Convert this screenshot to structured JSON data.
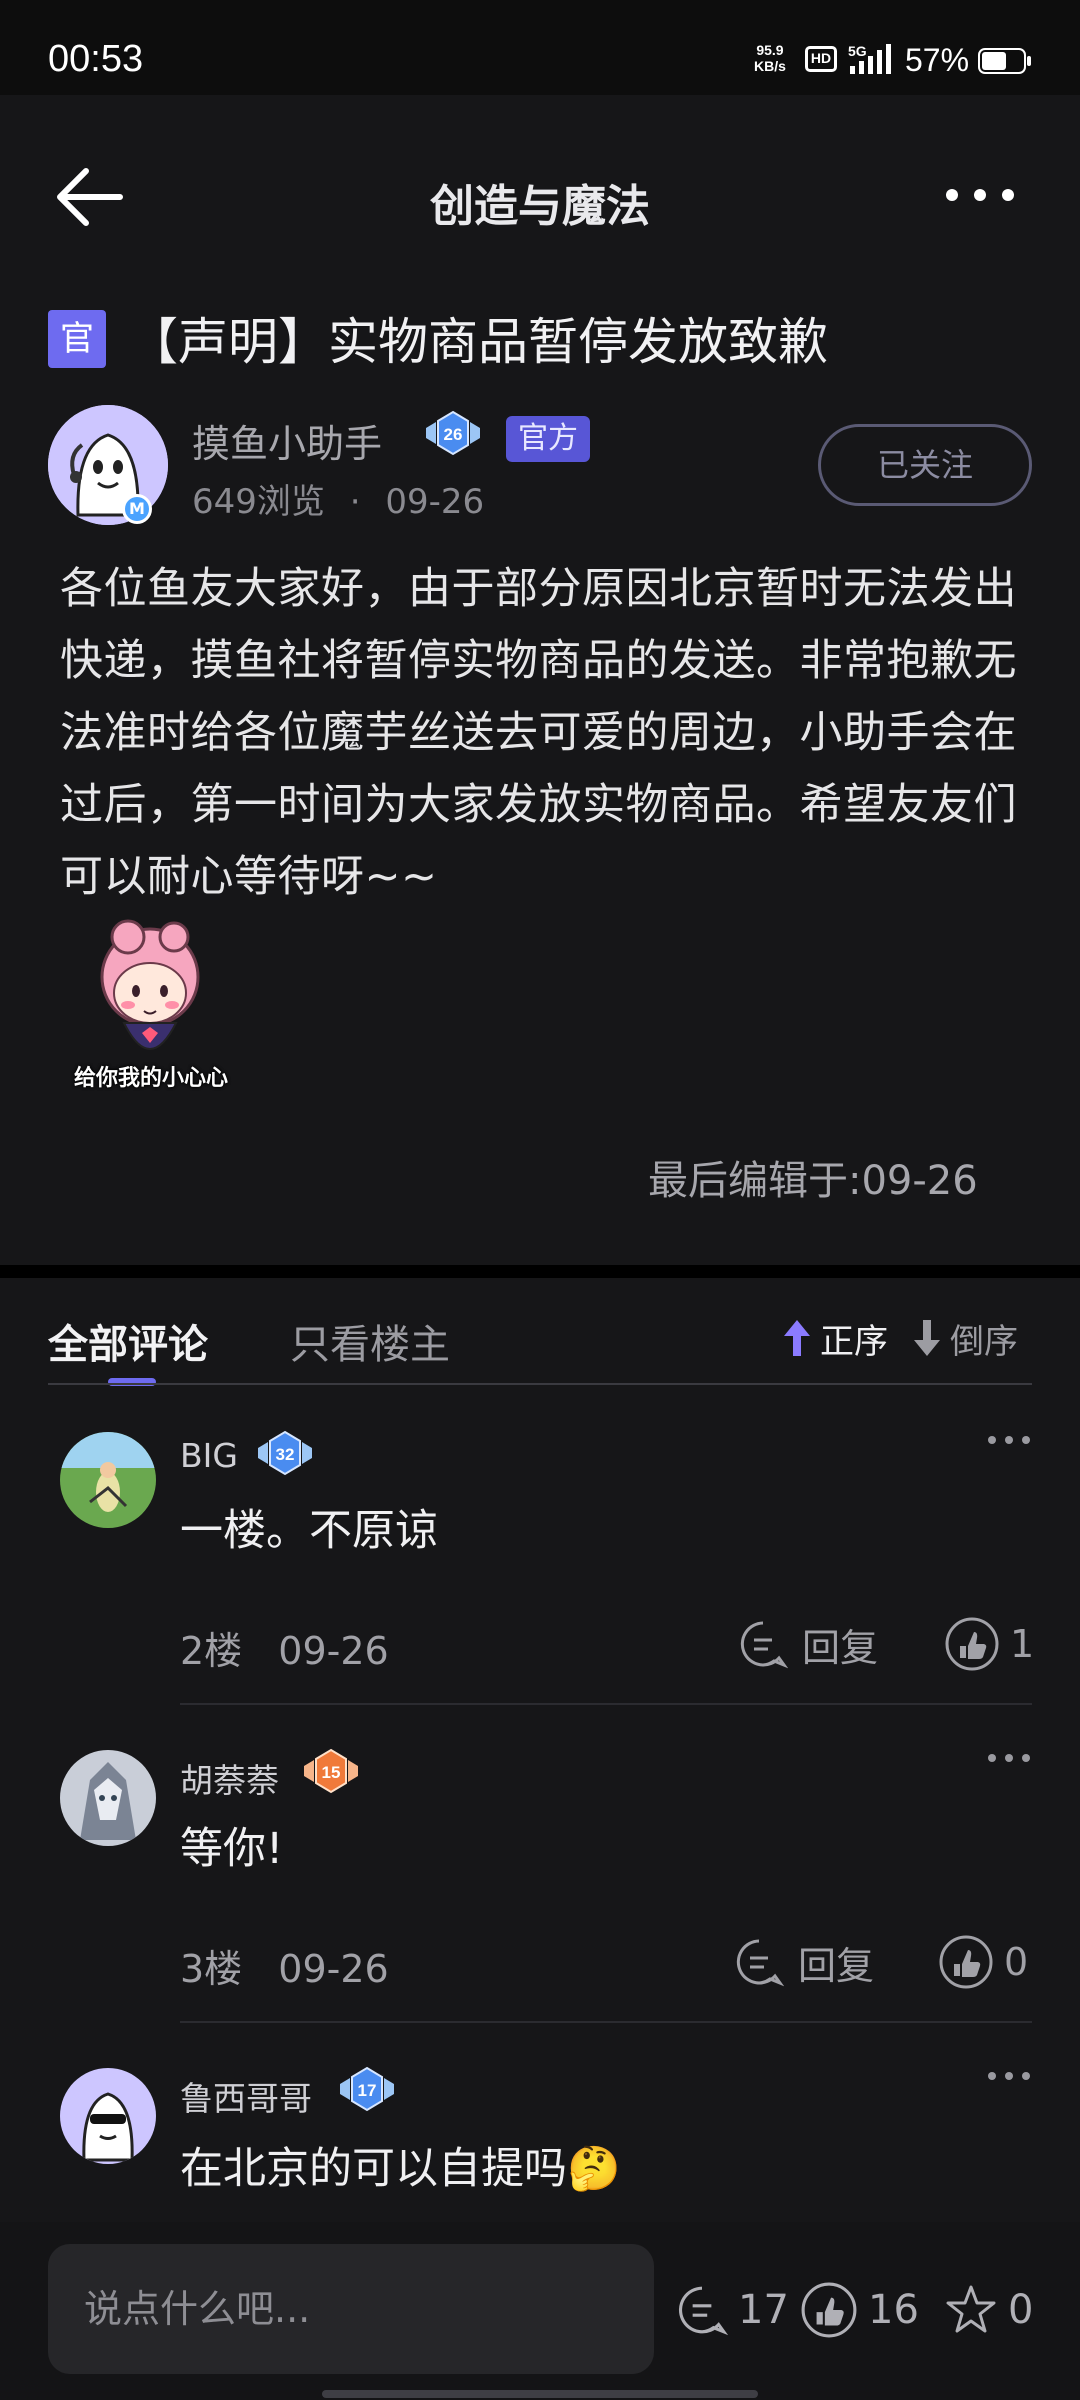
{
  "status_bar": {
    "time": "00:53",
    "net_speed_value": "95.9",
    "net_speed_unit": "KB/s",
    "hd_label": "HD",
    "network": "5G",
    "battery": "57%"
  },
  "nav": {
    "title": "创造与魔法",
    "back_icon": "arrow-left-icon",
    "more_icon": "more-horizontal-icon"
  },
  "post": {
    "official_tag": "官",
    "title": "【声明】实物商品暂停发放致歉",
    "author": {
      "name": "摸鱼小助手",
      "avatar_badge": "M",
      "level": "26",
      "official_label": "官方",
      "views": "649浏览",
      "separator": "·",
      "date": "09-26",
      "follow_label": "已关注"
    },
    "body": "各位鱼友大家好，由于部分原因北京暂时无法发出快递，摸鱼社将暂停实物商品的发送。非常抱歉无法准时给各位魔芋丝送去可爱的周边，小助手会在过后，第一时间为大家发放实物商品。希望友友们可以耐心等待呀~~",
    "sticker_caption": "给你我的小心心",
    "edited": "最后编辑于:09-26"
  },
  "comments_section": {
    "tabs": [
      {
        "label": "全部评论",
        "active": true
      },
      {
        "label": "只看楼主",
        "active": false
      }
    ],
    "sort_asc": "正序",
    "sort_desc": "倒序",
    "comments": [
      {
        "user": "BIG",
        "level": "32",
        "text": "一楼。不原谅",
        "floor": "2楼",
        "date": "09-26",
        "reply_label": "回复",
        "likes": "1"
      },
      {
        "user": "胡萘萘",
        "level": "15",
        "text": "等你!",
        "floor": "3楼",
        "date": "09-26",
        "reply_label": "回复",
        "likes": "0"
      },
      {
        "user": "鲁西哥哥",
        "level": "17",
        "text": "在北京的可以自提吗",
        "emoji": "🤔"
      }
    ]
  },
  "bottom_bar": {
    "input_placeholder": "说点什么吧...",
    "comments_count": "17",
    "likes_count": "16",
    "favorites_count": "0"
  },
  "colors": {
    "accent": "#6e6bf0",
    "official_badge": "#5856d6",
    "background": "#161618",
    "level_blue": "#4a8cf0",
    "level_orange": "#f07a3a"
  }
}
